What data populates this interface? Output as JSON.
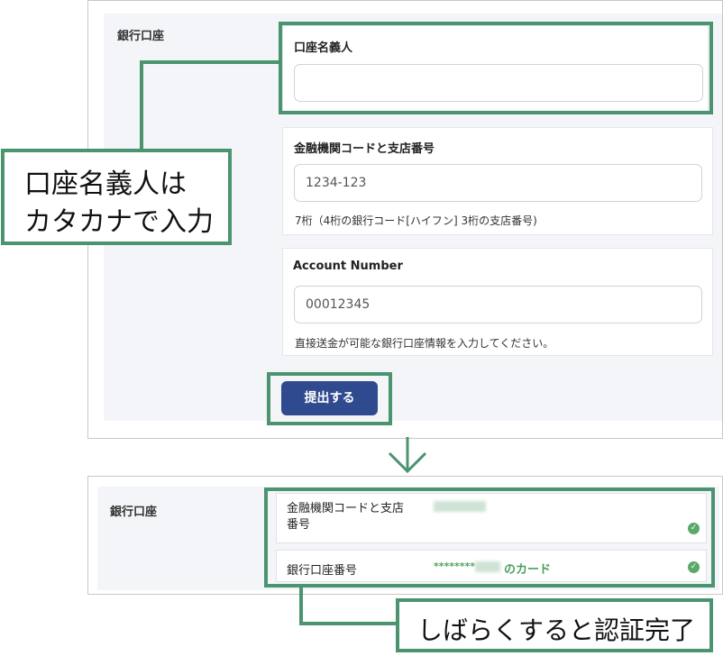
{
  "top_form": {
    "section_label": "銀行口座",
    "account_holder": {
      "label": "口座名義人",
      "value": ""
    },
    "branch_code": {
      "label": "金融機関コードと支店番号",
      "placeholder": "1234-123",
      "help": "7桁（4桁の銀行コード[ハイフン] 3桁の支店番号)"
    },
    "account_number": {
      "label": "Account Number",
      "placeholder": "00012345",
      "help": "直接送金が可能な銀行口座情報を入力してください。"
    },
    "submit_label": "提出する"
  },
  "callout_top": {
    "line1": "口座名義人は",
    "line2": "カタカナで入力"
  },
  "arrow_icon": "chevron-down",
  "bottom_form": {
    "section_label": "銀行口座",
    "rows": [
      {
        "label": "金融機関コードと支店\n番号",
        "status_icon": "check-circle"
      },
      {
        "label": "銀行口座番号",
        "masked": "********",
        "suffix": "のカード",
        "status_icon": "check-circle"
      }
    ]
  },
  "callout_bottom": {
    "text": "しばらくすると認証完了"
  },
  "colors": {
    "accent_green": "#4a9470",
    "button_blue": "#2f4a8f",
    "verified_green": "#5aa86a"
  }
}
